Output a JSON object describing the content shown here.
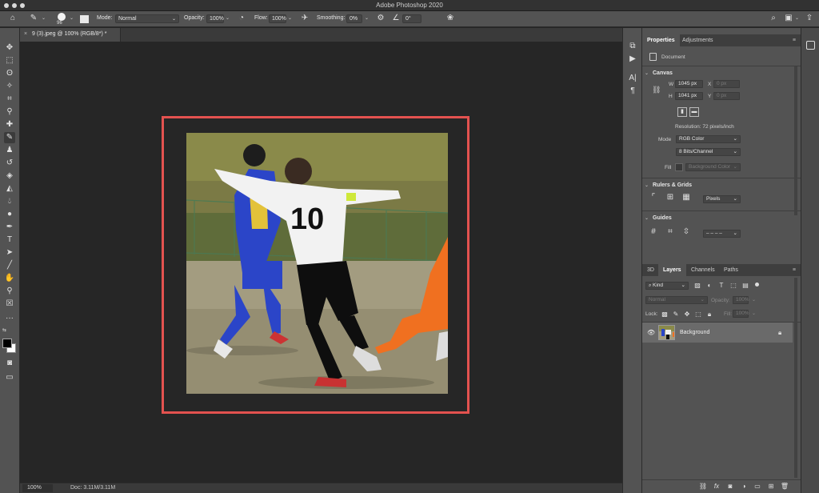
{
  "window": {
    "title": "Adobe Photoshop 2020"
  },
  "options_bar": {
    "brush_size": "96",
    "mode_label": "Mode:",
    "mode_value": "Normal",
    "opacity_label": "Opacity:",
    "opacity_value": "100%",
    "flow_label": "Flow:",
    "flow_value": "100%",
    "smoothing_label": "Smoothing:",
    "smoothing_value": "0%",
    "angle_value": "0°"
  },
  "document": {
    "tab_label": "9 (3).jpeg @ 100% (RGB/8*) *",
    "close_glyph": "×"
  },
  "status_bar": {
    "zoom": "100%",
    "doc_size": "Doc: 3.11M/3.11M"
  },
  "properties": {
    "tabs": [
      "Properties",
      "Adjustments"
    ],
    "document_label": "Document",
    "canvas_header": "Canvas",
    "w_label": "W",
    "w_value": "1045 px",
    "h_label": "H",
    "h_value": "1041 px",
    "x_label": "X",
    "x_value": "0 px",
    "y_label": "Y",
    "y_value": "0 px",
    "resolution": "Resolution: 72 pixels/inch",
    "mode_label": "Mode",
    "mode_value": "RGB Color",
    "bits_value": "8 Bits/Channel",
    "fill_label": "Fill",
    "fill_value": "Background Color",
    "rulers_header": "Rulers & Grids",
    "units_value": "Pixels",
    "guides_header": "Guides",
    "guides_style": "– – – –"
  },
  "layers": {
    "tabs": [
      "3D",
      "Layers",
      "Channels",
      "Paths"
    ],
    "kind_label": "Kind",
    "blend_value": "Normal",
    "opacity_label": "Opacity:",
    "opacity_value": "100%",
    "lock_label": "Lock:",
    "fill_label": "Fill:",
    "fill_value": "100%",
    "layer_name": "Background"
  },
  "colors": {
    "accent_outline": "#e3524f",
    "panel_bg": "#535353",
    "canvas_bg": "#262626"
  }
}
